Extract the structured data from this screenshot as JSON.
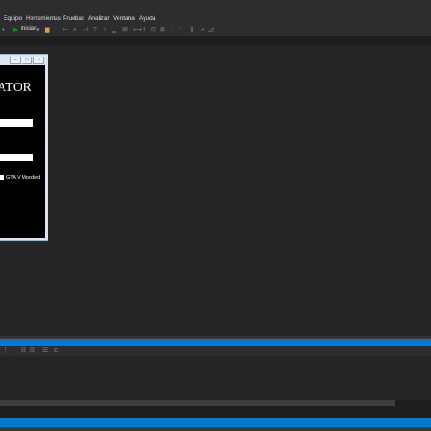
{
  "menu": {
    "items": [
      {
        "label": "Equipo"
      },
      {
        "label": "Herramientas"
      },
      {
        "label": "Pruebas"
      },
      {
        "label": "Analizar"
      },
      {
        "label": "Ventana"
      },
      {
        "label": "Ayuda"
      }
    ]
  },
  "toolbar": {
    "start_label": "Iniciar",
    "start_icon": "play-icon",
    "accent_color": "#00a000"
  },
  "designer_form": {
    "title_text": "ATOR",
    "checkbox_label": "GTA V Modded",
    "checkbox_checked": false
  },
  "theme": {
    "editor_background": "#1e1e1e",
    "status_bar_color": "#007acc"
  }
}
